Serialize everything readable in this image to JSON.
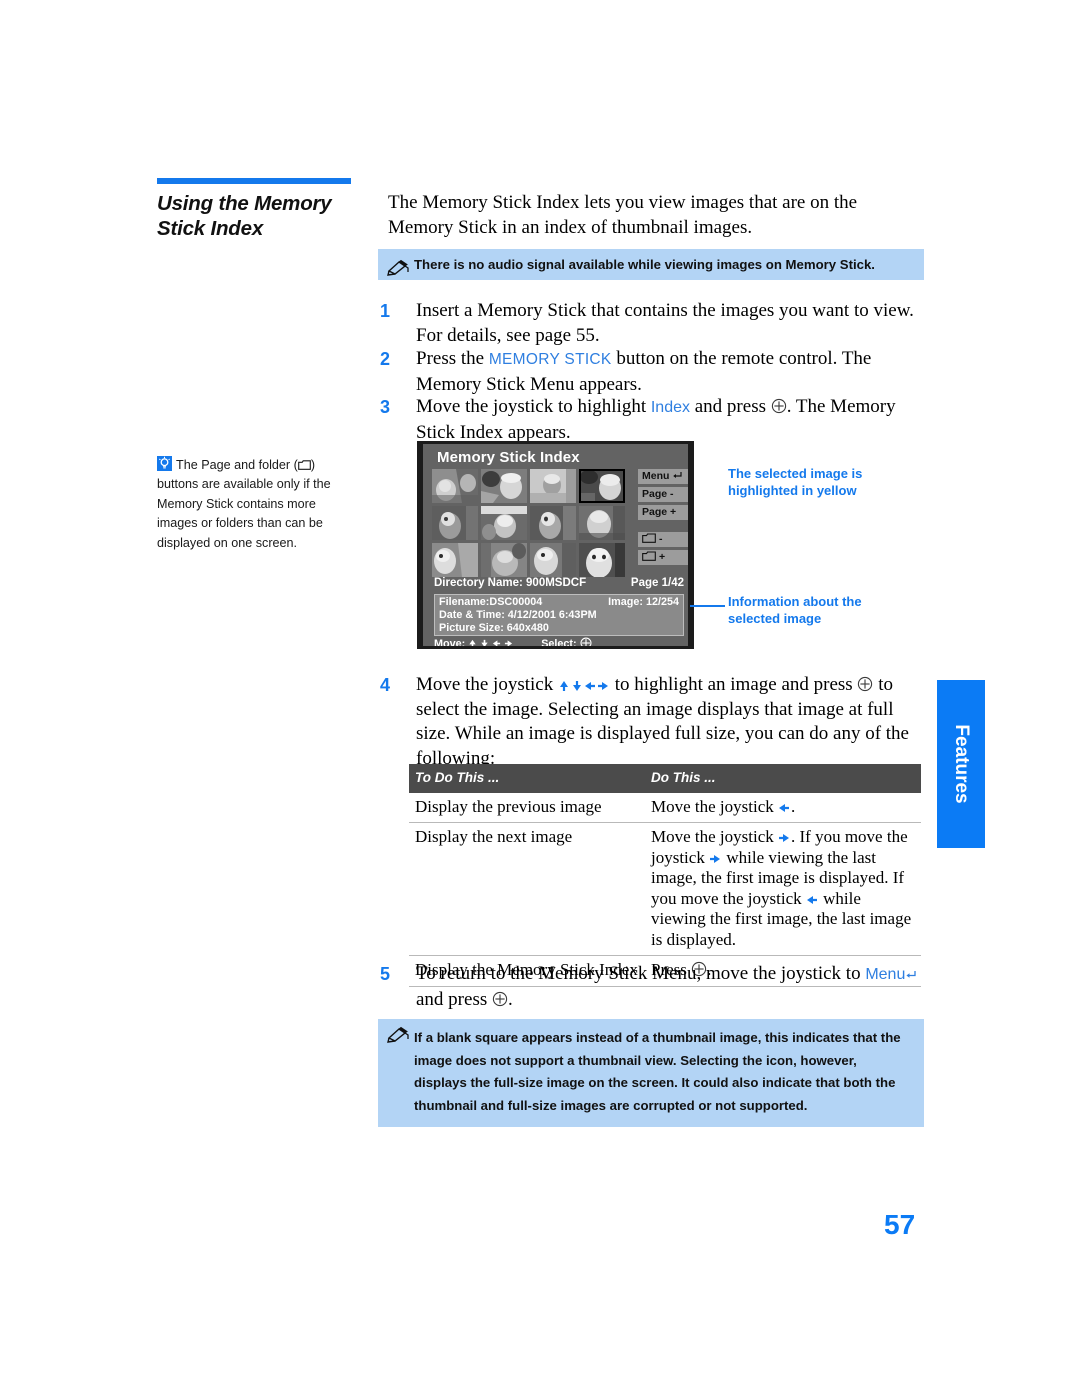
{
  "heading": {
    "line1": "Using the Memory",
    "line2": "Stick Index",
    "rule_color": "#1479ec"
  },
  "intro": {
    "text": "The Memory Stick Index lets you view images that are on the Memory Stick in an index of thumbnail images."
  },
  "notes": {
    "top": "There is no audio signal available while viewing images on Memory Stick.",
    "bottom": "If a blank square appears instead of a thumbnail image, this indicates that the image does not support a thumbnail view. Selecting the icon, however, displays the full-size image on the screen. It could also indicate that both the thumbnail and full-size images are corrupted or not supported.",
    "background": "#b3d4f5"
  },
  "sidebar_tip": {
    "part1": "The Page and folder (",
    "part2": ") buttons are available only if the Memory Stick contains more images or folders than can be displayed on one screen."
  },
  "steps": [
    {
      "num": "1",
      "text": "Insert a Memory Stick that contains the images you want to view. For details, see page 55."
    },
    {
      "num": "2",
      "pre": "Press the ",
      "ui": "MEMORY STICK",
      "post": " button on the remote control. The Memory Stick Menu appears."
    },
    {
      "num": "3",
      "pre": "Move the joystick to highlight ",
      "ui": "Index",
      "mid": " and press ",
      "post": ". The Memory Stick Index appears."
    },
    {
      "num": "4",
      "pre": "Move the joystick ",
      "mid": " to highlight an image and press ",
      "post": " to select the image. Selecting an image displays that image at full size. While an image is displayed full size, you can do any of the following:"
    },
    {
      "num": "5",
      "pre": "To return to the Memory Stick Menu, move the joystick to ",
      "ui": "Menu",
      "mid": " and press ",
      "post": "."
    }
  ],
  "tv_screen": {
    "title": "Memory Stick Index",
    "buttons": [
      {
        "label": "Menu",
        "icon": "return-arrow-icon"
      },
      {
        "label": "Page -",
        "icon": null
      },
      {
        "label": "Page +",
        "icon": null
      },
      {
        "label": "-",
        "icon": "folder-icon"
      },
      {
        "label": "+",
        "icon": "folder-icon"
      }
    ],
    "directory_label": "Directory Name: 900MSDCF",
    "page_label": "Page 1/42",
    "info": {
      "filename": "Filename:DSC00004",
      "image_count": "Image: 12/254",
      "datetime": "Date & Time: 4/12/2001 6:43PM",
      "picture_size": "Picture Size: 640x480"
    },
    "move_label": "Move:",
    "select_label": "Select:",
    "thumbnail_count": 12,
    "selected_index": 3,
    "background": "#636363"
  },
  "callouts": {
    "selected": "The selected image is highlighted in yellow",
    "info": "Information about the selected image",
    "color": "#1479ec"
  },
  "table": {
    "headers": [
      "To Do This ...",
      "Do This ..."
    ],
    "rows": [
      {
        "todo": "Display the previous image",
        "do_pre": "Move the joystick ",
        "do_post": "."
      },
      {
        "todo": "Display the next image",
        "do_pre": "Move the joystick ",
        "do_a": ". If you move the joystick ",
        "do_b": " while viewing the last image, the first image is displayed. If you move the joystick ",
        "do_c": " while viewing the first image, the last image is displayed."
      },
      {
        "todo": "Display the Memory Stick Index",
        "do_pre": "Press ",
        "do_post": "."
      }
    ],
    "header_background": "#4b4b4b"
  },
  "side_tab": {
    "label": "Features",
    "color": "#0b7bf5"
  },
  "page_number": "57"
}
